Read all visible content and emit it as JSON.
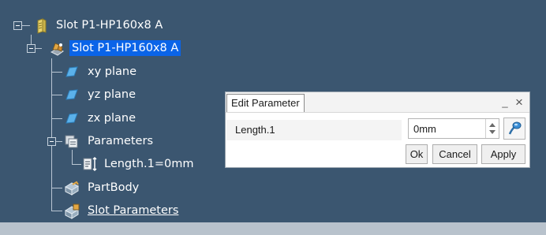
{
  "tree": {
    "root_label": "Slot P1-HP160x8 A",
    "part_label": "Slot P1-HP160x8 A",
    "planes": [
      "xy plane",
      "yz plane",
      "zx plane"
    ],
    "parameters_label": "Parameters",
    "parameter_item_label": "Length.1=0mm",
    "partbody_label": "PartBody",
    "slot_parameters_label": "Slot Parameters"
  },
  "dialog": {
    "title": "Edit Parameter",
    "minimize_glyph": "_",
    "close_glyph": "×",
    "parameter_name": "Length.1",
    "value": "0mm",
    "ok_label": "Ok",
    "cancel_label": "Cancel",
    "apply_label": "Apply"
  },
  "colors": {
    "background": "#3b5670",
    "selection": "#0a64e8",
    "dialog_background": "#ffffff"
  },
  "icons": {
    "root": "product-icon",
    "part": "part-icon",
    "plane": "plane-icon",
    "parameters": "parameters-icon",
    "parameter": "length-parameter-icon",
    "partbody": "partbody-icon",
    "slot_parameters": "knowledge-parameters-icon",
    "formula": "formula-icon"
  }
}
